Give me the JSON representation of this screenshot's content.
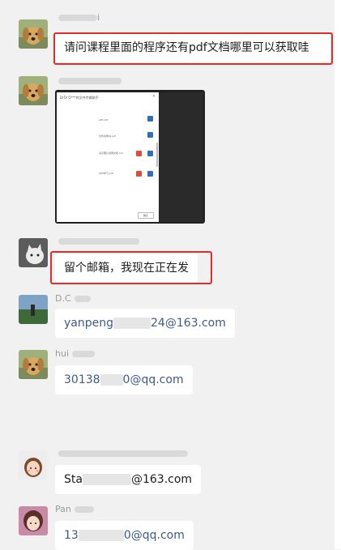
{
  "messages": [
    {
      "sender": "i",
      "text": "请问课程里面的程序还有pdf文档哪里可以获取哇",
      "avatar": "dog-avatar"
    },
    {
      "sender": "",
      "attachment": {
        "dialog_title": "DrDr'O***的文件传输助手",
        "rows": [
          "wifi.pdf",
          "文件说明书.pdf",
          "演示图片说明文档.md",
          "PHP学习.pdf"
        ],
        "button": "确定"
      },
      "avatar": "dog-avatar"
    },
    {
      "sender": "",
      "text": "留个邮箱，我现在正在发",
      "avatar": "cat-avatar"
    },
    {
      "sender": "D.C",
      "text_prefix": "yanpeng",
      "text_suffix": "24@163.com",
      "avatar": "landscape-avatar"
    },
    {
      "sender": "hui",
      "text_prefix": "30138",
      "text_suffix": "0@qq.com",
      "avatar": "dog-avatar"
    },
    {
      "sender": "",
      "text_prefix": "Sta",
      "text_suffix": "@163.com",
      "avatar": "girl-avatar"
    },
    {
      "sender": "Pan",
      "text_prefix": "13",
      "text_suffix": "0@qq.com",
      "avatar": "anime-avatar"
    }
  ],
  "colors": {
    "highlight": "#e32b2b",
    "bubble": "#ffffff",
    "background": "#f1f1f1",
    "link": "#3d5a8c"
  }
}
